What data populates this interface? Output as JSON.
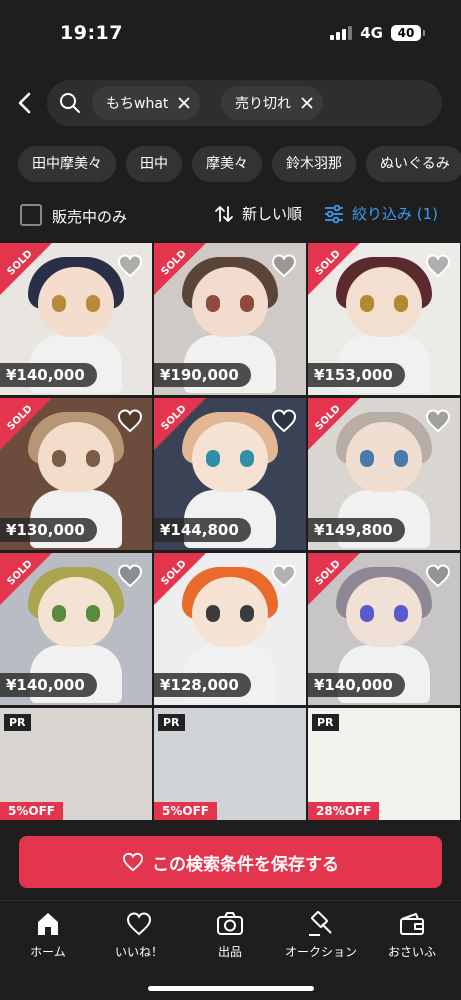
{
  "status_bar": {
    "time": "19:17",
    "network": "4G",
    "battery": "40"
  },
  "search": {
    "chips": [
      {
        "label": "もちwhat"
      },
      {
        "label": "売り切れ"
      }
    ]
  },
  "suggestions": [
    "田中摩美々",
    "田中",
    "摩美々",
    "鈴木羽那",
    "ぬいぐるみ"
  ],
  "filters": {
    "only_on_sale_label": "販売中のみ",
    "sort_label": "新しい順",
    "filter_label": "絞り込み (1)"
  },
  "items": [
    {
      "price": "¥140,000",
      "sold": "SOLD",
      "hair": "#2a2f47",
      "face": "#f4ddcc",
      "eye": "#b88a3a",
      "bg": "#e9e6e1"
    },
    {
      "price": "¥190,000",
      "sold": "SOLD",
      "hair": "#5b4439",
      "face": "#f1dccd",
      "eye": "#8e4a3c",
      "bg": "#cfcac6"
    },
    {
      "price": "¥153,000",
      "sold": "SOLD",
      "hair": "#5b2a2c",
      "face": "#f3dfd0",
      "eye": "#b3892e",
      "bg": "#ecebe8"
    },
    {
      "price": "¥130,000",
      "sold": "SOLD",
      "hair": "#b79675",
      "face": "#f1ddc9",
      "eye": "#7a5d48",
      "bg": "#6b4c3d"
    },
    {
      "price": "¥144,800",
      "sold": "SOLD",
      "hair": "#e1b794",
      "face": "#f5e2d2",
      "eye": "#2e8fa6",
      "bg": "#3a4356"
    },
    {
      "price": "¥149,800",
      "sold": "SOLD",
      "hair": "#b7ada5",
      "face": "#f0ded3",
      "eye": "#4a78a8",
      "bg": "#d9d6d2"
    },
    {
      "price": "¥140,000",
      "sold": "SOLD",
      "hair": "#a9a64f",
      "face": "#f3e3d3",
      "eye": "#5a8a3c",
      "bg": "#b9bcc2"
    },
    {
      "price": "¥128,000",
      "sold": "SOLD",
      "hair": "#ea6a2b",
      "face": "#f6e3d4",
      "eye": "#3c3c3c",
      "bg": "#eeeeee"
    },
    {
      "price": "¥140,000",
      "sold": "SOLD",
      "hair": "#8e8895",
      "face": "#f0e0d6",
      "eye": "#5a5ad0",
      "bg": "#c8c5c6"
    }
  ],
  "ads": [
    {
      "pr": "PR",
      "discount": "5%OFF"
    },
    {
      "pr": "PR",
      "discount": "5%OFF"
    },
    {
      "pr": "PR",
      "discount": "28%OFF"
    }
  ],
  "save_button": {
    "label": "この検索条件を保存する"
  },
  "tabs": [
    {
      "label": "ホーム"
    },
    {
      "label": "いいね！"
    },
    {
      "label": "出品"
    },
    {
      "label": "オークション"
    },
    {
      "label": "おさいふ"
    }
  ],
  "colors": {
    "accent": "#e3364e",
    "link": "#3d9bf2",
    "background": "#1e1e1e"
  }
}
